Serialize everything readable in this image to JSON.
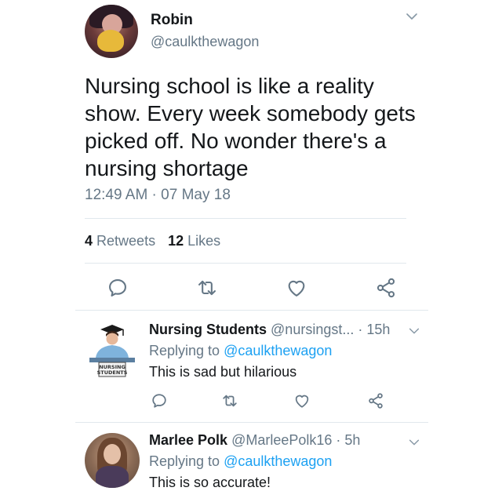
{
  "tweet": {
    "author_name": "Robin",
    "author_handle": "@caulkthewagon",
    "text": "Nursing school is like a reality show. Every week somebody gets picked off. No wonder there's a nursing shortage",
    "timestamp": "12:49 AM · 07 May 18",
    "retweets_count": "4",
    "retweets_label": "Retweets",
    "likes_count": "12",
    "likes_label": "Likes"
  },
  "replies": [
    {
      "name": "Nursing Students",
      "handle": "@nursingst...",
      "time": "· 15h",
      "replying_prefix": "Replying to",
      "replying_to": "@caulkthewagon",
      "text": "This is sad but hilarious",
      "avatar_text": "NURSING STUDENTS"
    },
    {
      "name": "Marlee Polk",
      "handle": "@MarleePolk16",
      "time": "· 5h",
      "replying_prefix": "Replying to",
      "replying_to": "@caulkthewagon",
      "text": "This is so accurate!"
    }
  ],
  "icons": {
    "reply": "reply-icon",
    "retweet": "retweet-icon",
    "like": "heart-icon",
    "share": "share-icon",
    "more": "chevron-down-icon"
  },
  "colors": {
    "text": "#14171a",
    "secondary": "#657786",
    "link": "#1da1f2",
    "divider": "#e1e8ed"
  }
}
